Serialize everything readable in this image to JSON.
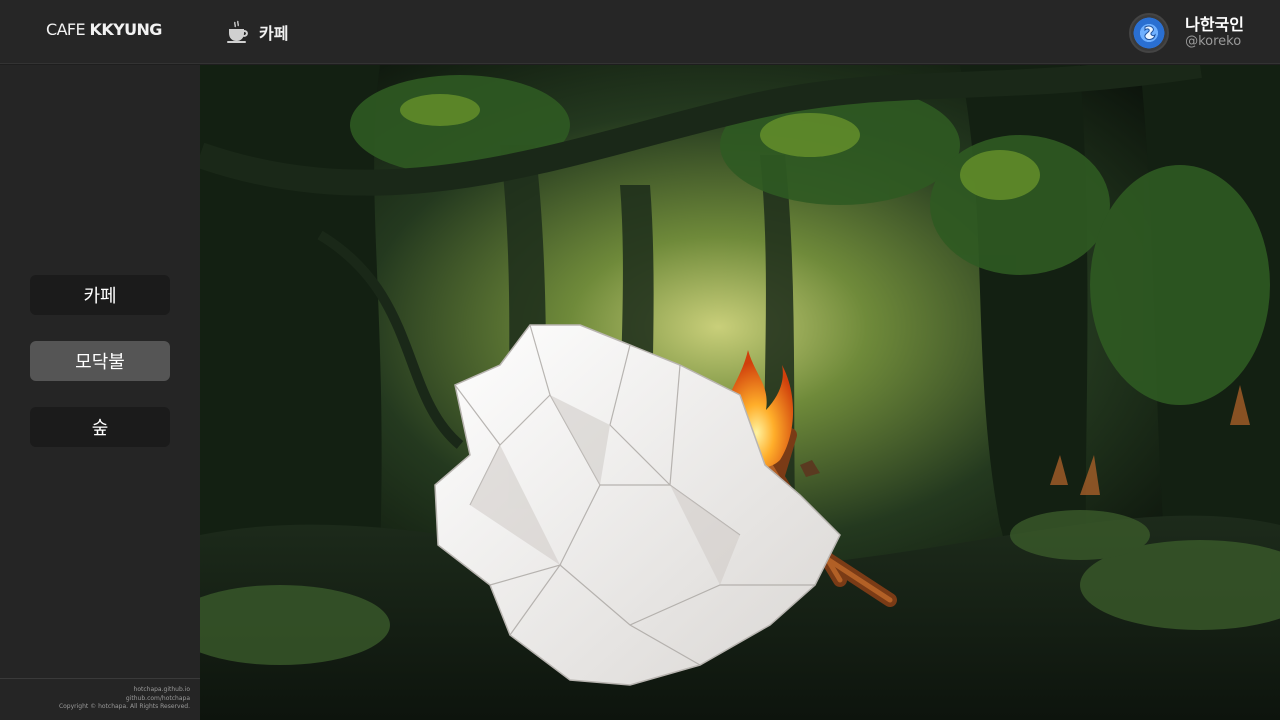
{
  "brand": {
    "part1": "CAFE ",
    "part2": "KKYUNG"
  },
  "breadcrumb": {
    "icon": "coffee-cup-icon",
    "label": "카페"
  },
  "profile": {
    "name": "나한국인",
    "handle": "@koreko",
    "avatar_icon": "dragon-avatar-icon"
  },
  "sidebar": {
    "items": [
      {
        "label": "카페",
        "active": false
      },
      {
        "label": "모닥불",
        "active": true
      },
      {
        "label": "숲",
        "active": false
      }
    ]
  },
  "footer": {
    "line1": "hotchapa.github.io",
    "line2": "github.com/hotchapa",
    "line3": "Copyright © hotchapa. All Rights Reserved."
  },
  "scene": {
    "description_icons": [
      "forest-background",
      "campfire-icon",
      "crumpled-paper-icon"
    ]
  }
}
